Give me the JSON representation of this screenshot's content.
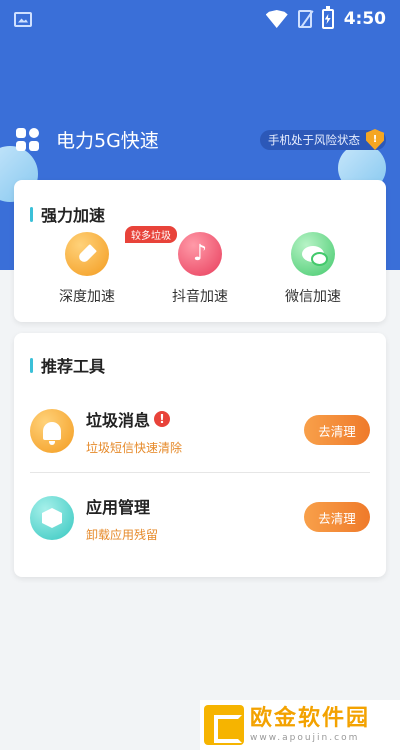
{
  "status_bar": {
    "time": "4:50"
  },
  "header": {
    "app_title": "电力5G快速",
    "risk_badge": "手机处于风险状态"
  },
  "boost": {
    "section_title": "强力加速",
    "items": [
      {
        "label": "深度加速",
        "tag": "较多垃圾"
      },
      {
        "label": "抖音加速"
      },
      {
        "label": "微信加速"
      }
    ]
  },
  "tools": {
    "section_title": "推荐工具",
    "items": [
      {
        "name": "垃圾消息",
        "desc": "垃圾短信快速清除",
        "button": "去清理"
      },
      {
        "name": "应用管理",
        "desc": "卸载应用残留",
        "button": "去清理"
      }
    ]
  },
  "watermark": {
    "text": "欧金软件园",
    "url": "www.apoujin.com"
  },
  "colors": {
    "header_blue": "#3a6fd8",
    "accent_teal": "#3bc0d8",
    "button_orange": "#ef7a2a",
    "alert_red": "#e8433a"
  }
}
